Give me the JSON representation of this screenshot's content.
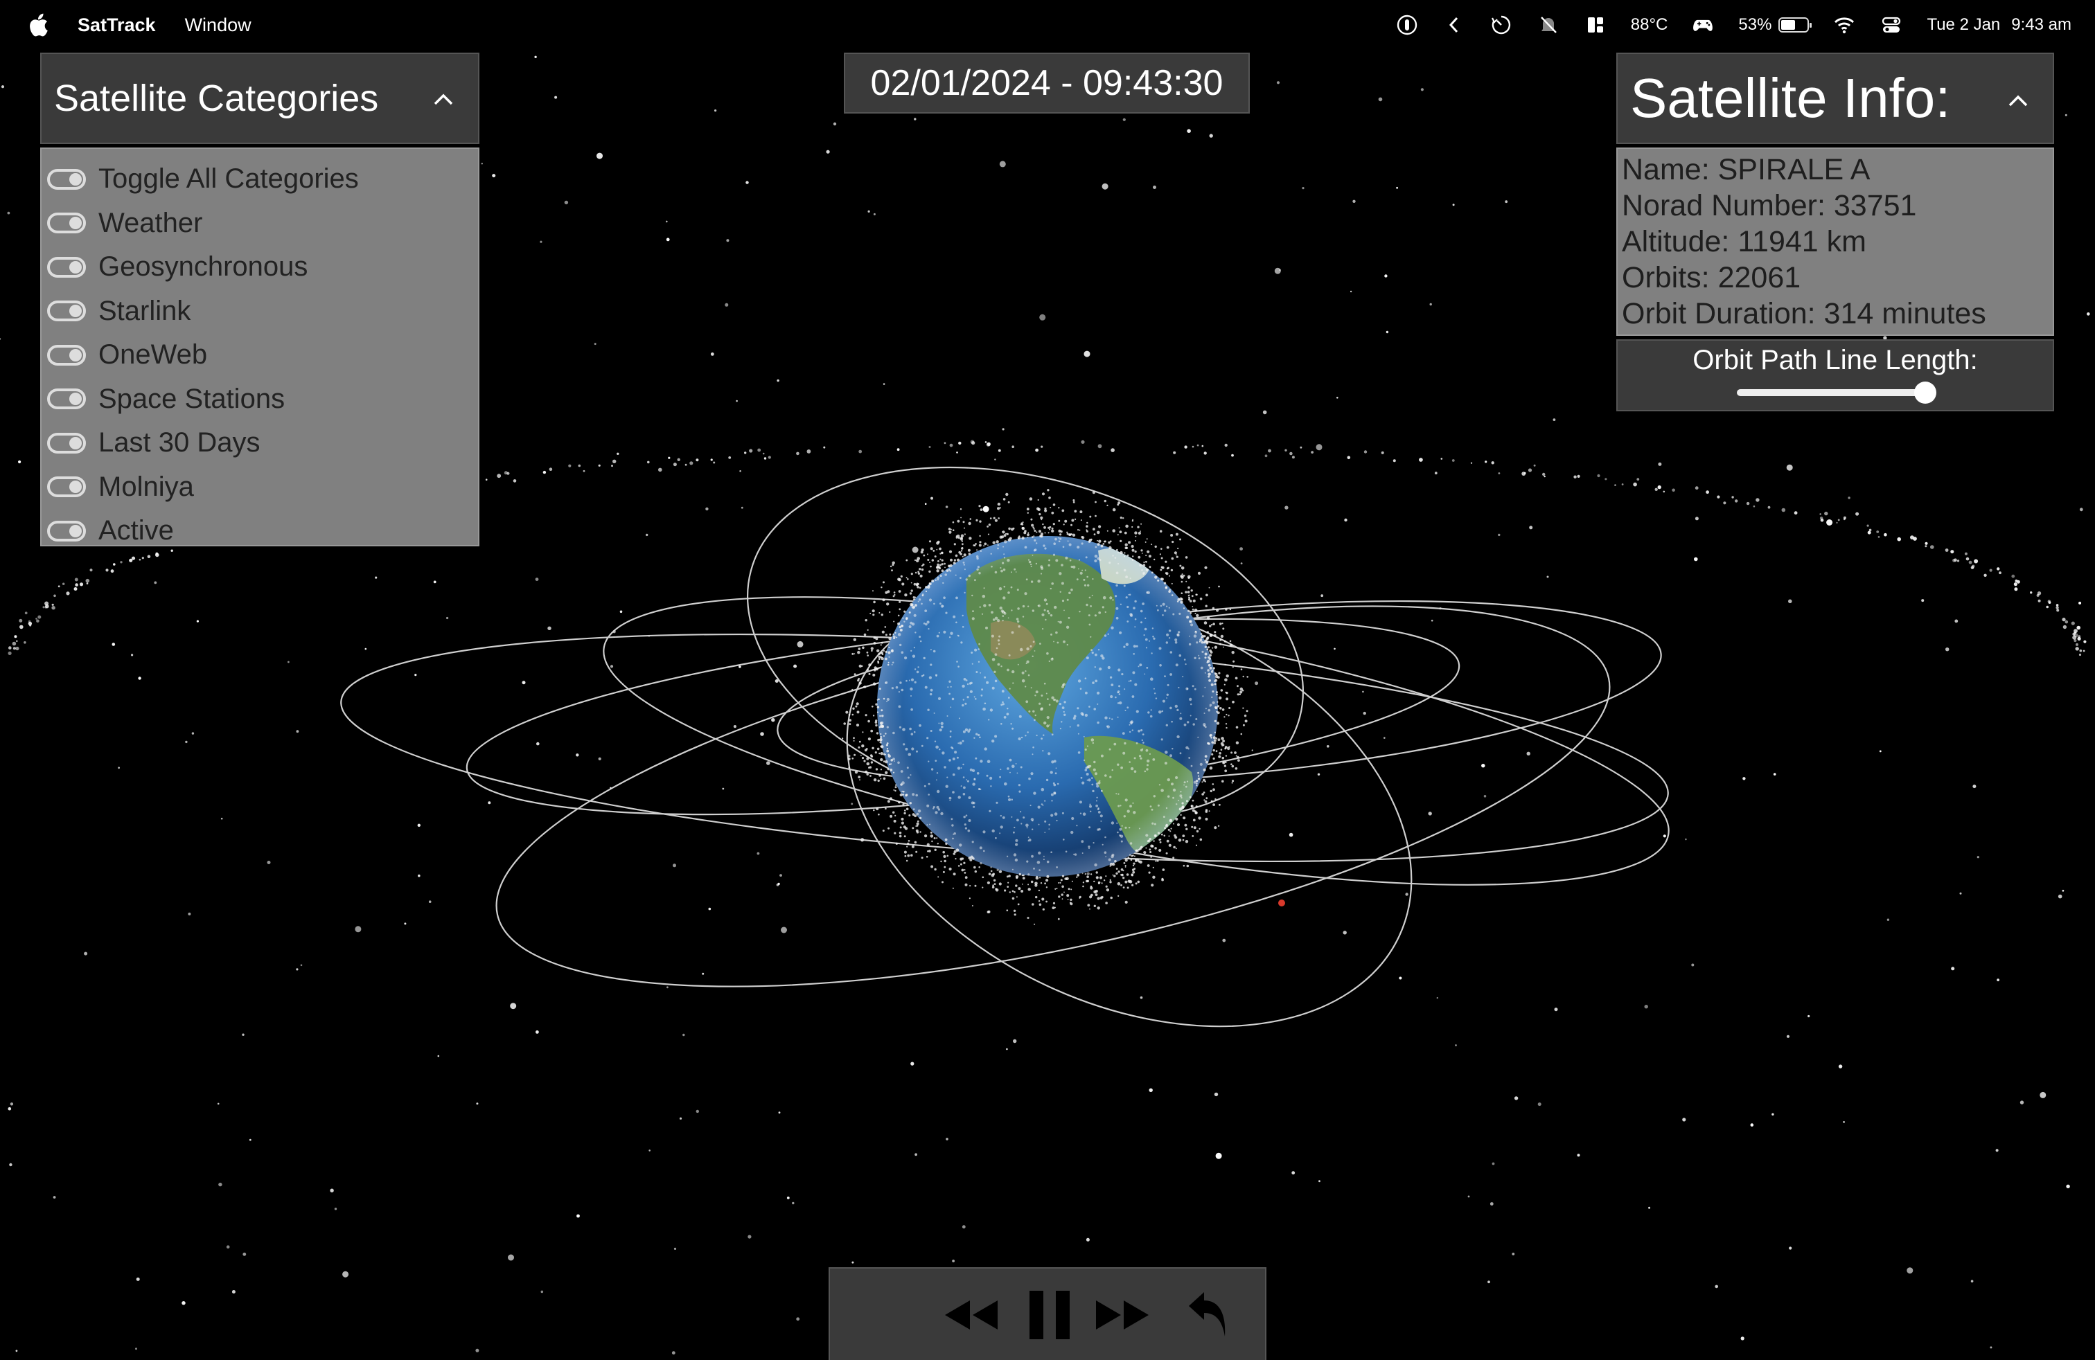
{
  "menubar": {
    "app_name": "SatTrack",
    "menus": [
      "Window"
    ],
    "temperature": "88°C",
    "battery_percent": "53%",
    "battery_level": 0.53,
    "date": "Tue 2 Jan",
    "time": "9:43 am",
    "status_icons": [
      "tv-remote-icon",
      "chevron-left-icon",
      "timer-icon",
      "muted-bell-icon",
      "layout-icon",
      "gamepad-icon",
      "wifi-icon",
      "control-center-icon"
    ]
  },
  "datetime_display": "02/01/2024 - 09:43:30",
  "categories": {
    "title": "Satellite Categories",
    "items": [
      {
        "label": "Toggle All Categories",
        "on": true
      },
      {
        "label": "Weather",
        "on": true
      },
      {
        "label": "Geosynchronous",
        "on": true
      },
      {
        "label": "Starlink",
        "on": true
      },
      {
        "label": "OneWeb",
        "on": true
      },
      {
        "label": "Space Stations",
        "on": true
      },
      {
        "label": "Last 30 Days",
        "on": true
      },
      {
        "label": "Molniya",
        "on": true
      },
      {
        "label": "Active",
        "on": true
      }
    ]
  },
  "satellite_info": {
    "title": "Satellite Info:",
    "name": "Name: SPIRALE A",
    "norad": "Norad Number: 33751",
    "altitude": "Altitude: 11941 km",
    "orbits": "Orbits: 22061",
    "orbit_duration": "Orbit Duration: 314 minutes"
  },
  "orbit_path": {
    "label": "Orbit Path Line Length:",
    "value": 0.97
  },
  "playback": {
    "buttons": [
      "rewind-icon",
      "pause-icon",
      "fast-forward-icon",
      "reset-icon"
    ]
  },
  "colors": {
    "background": "#000000",
    "panel_dark": "#3a3a3a",
    "panel_light": "#808080",
    "selected_satellite": "#d8392b"
  }
}
